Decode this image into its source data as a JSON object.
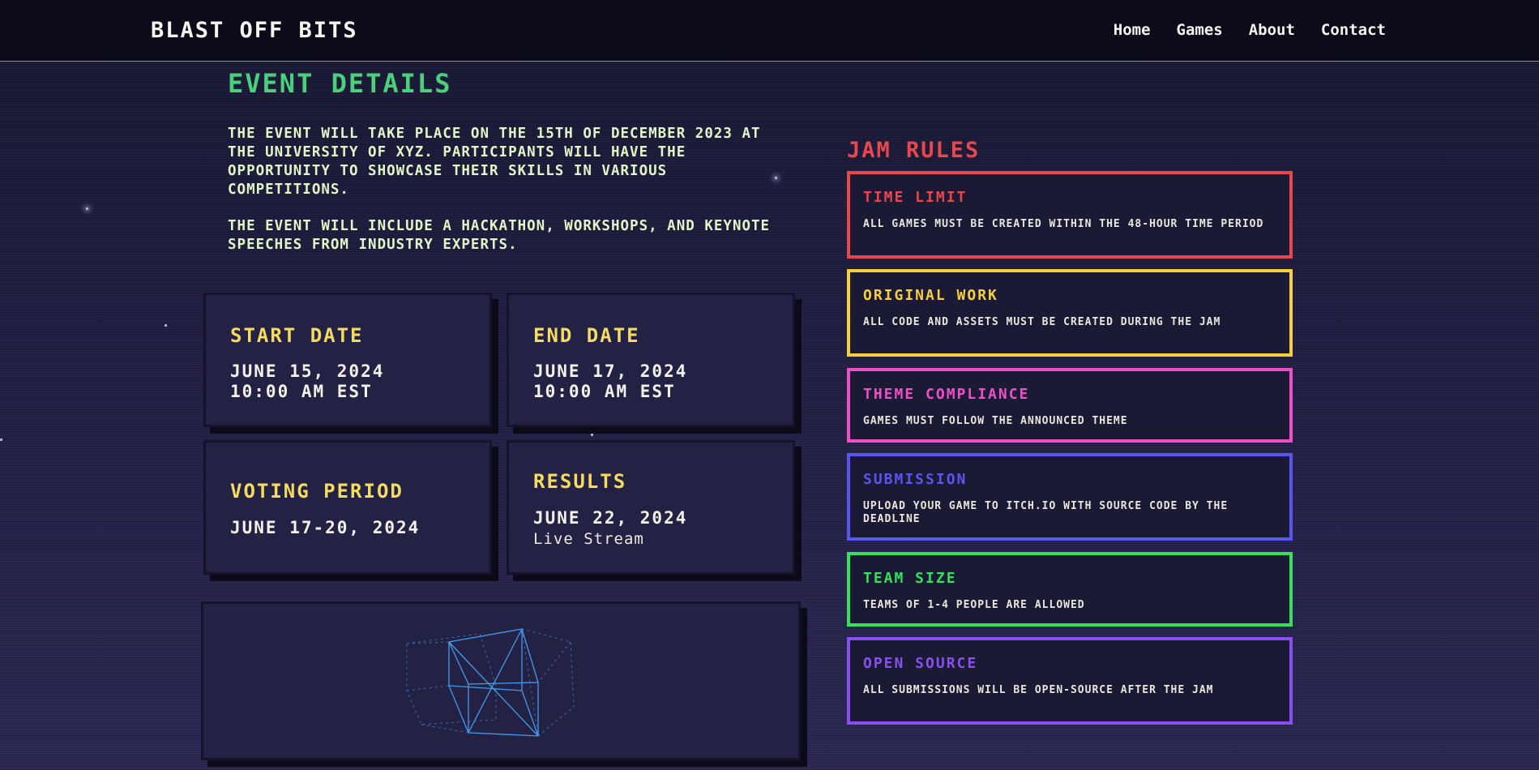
{
  "header": {
    "logo": "BLAST OFF BITS",
    "nav": [
      "Home",
      "Games",
      "About",
      "Contact"
    ]
  },
  "event": {
    "title": "EVENT DETAILS",
    "paragraphs": [
      "THE EVENT WILL TAKE PLACE ON THE 15TH OF DECEMBER 2023 AT THE UNIVERSITY OF XYZ. PARTICIPANTS WILL HAVE THE OPPORTUNITY TO SHOWCASE THEIR SKILLS IN VARIOUS COMPETITIONS.",
      "THE EVENT WILL INCLUDE A HACKATHON, WORKSHOPS, AND KEYNOTE SPEECHES FROM INDUSTRY EXPERTS."
    ]
  },
  "dates": [
    {
      "title": "START DATE",
      "lines": [
        "JUNE 15, 2024",
        "10:00 AM EST"
      ]
    },
    {
      "title": "END DATE",
      "lines": [
        "JUNE 17, 2024",
        "10:00 AM EST"
      ]
    },
    {
      "title": "VOTING PERIOD",
      "lines": [
        "JUNE 17-20, 2024"
      ]
    },
    {
      "title": "RESULTS",
      "lines": [
        "JUNE 22, 2024"
      ],
      "sub": "Live Stream"
    }
  ],
  "rules": {
    "title": "JAM RULES",
    "items": [
      {
        "title": "TIME LIMIT",
        "desc": "ALL GAMES MUST BE CREATED WITHIN THE 48-HOUR TIME PERIOD",
        "color": "#e8484c"
      },
      {
        "title": "ORIGINAL WORK",
        "desc": "ALL CODE AND ASSETS MUST BE CREATED DURING THE JAM",
        "color": "#f5d039"
      },
      {
        "title": "THEME COMPLIANCE",
        "desc": "GAMES MUST FOLLOW THE ANNOUNCED THEME",
        "color": "#ef4fc8"
      },
      {
        "title": "SUBMISSION",
        "desc": "UPLOAD YOUR GAME TO ITCH.IO WITH SOURCE CODE BY THE DEADLINE",
        "color": "#5a55ef"
      },
      {
        "title": "TEAM SIZE",
        "desc": "TEAMS OF 1-4 PEOPLE ARE ALLOWED",
        "color": "#35e05a"
      },
      {
        "title": "OPEN SOURCE",
        "desc": "ALL SUBMISSIONS WILL BE OPEN-SOURCE AFTER THE JAM",
        "color": "#8a4ff0"
      }
    ]
  },
  "colors": {
    "accent_green": "#4ad07b",
    "date_title_yellow": "#f5dc5f",
    "cube_blue": "#4aa6ff"
  },
  "icons": {
    "cube": "wireframe-cube-icon"
  }
}
